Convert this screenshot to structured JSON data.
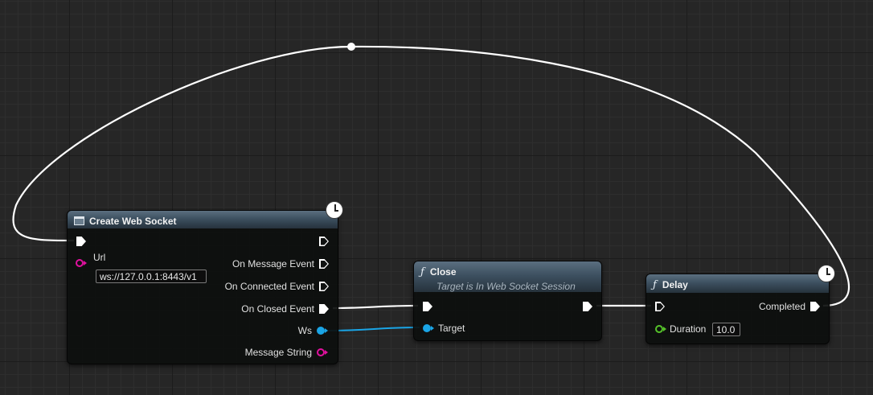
{
  "nodes": {
    "create_web_socket": {
      "title": "Create Web Socket",
      "url_label": "Url",
      "url_value": "ws://127.0.0.1:8443/v1",
      "outputs": [
        "On Message Event",
        "On Connected Event",
        "On Closed Event",
        "Ws",
        "Message String"
      ]
    },
    "close": {
      "title": "Close",
      "subtitle": "Target is In Web Socket Session",
      "target_label": "Target"
    },
    "delay": {
      "title": "Delay",
      "completed_label": "Completed",
      "duration_label": "Duration",
      "duration_value": "10.0"
    }
  },
  "colors": {
    "exec_wire": "#ffffff",
    "object_wire": "#1aa5e6",
    "string_pin": "#e1119f",
    "float_pin": "#55c22a",
    "header": "#3d5060"
  },
  "icons": {
    "create_web_socket": "event-box-icon",
    "close": "function-icon",
    "delay": "function-icon",
    "latent": "clock-icon"
  }
}
